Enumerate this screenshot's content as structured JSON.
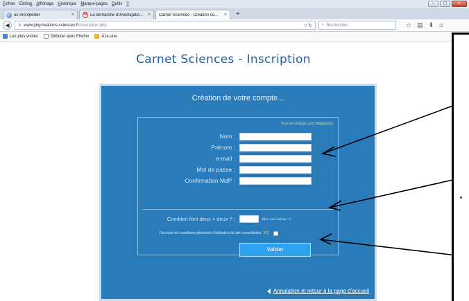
{
  "browser": {
    "menu": [
      {
        "pre": "",
        "u": "F",
        "post": "ichier"
      },
      {
        "pre": "Éditio",
        "u": "n",
        "post": ""
      },
      {
        "pre": "",
        "u": "A",
        "post": "ffichage"
      },
      {
        "pre": "",
        "u": "H",
        "post": "istorique"
      },
      {
        "pre": "",
        "u": "M",
        "post": "arque-pages"
      },
      {
        "pre": "",
        "u": "O",
        "post": "utils"
      },
      {
        "pre": "",
        "u": "?",
        "post": ""
      }
    ],
    "tabs": [
      {
        "label": "ac-montpellier",
        "close": "×"
      },
      {
        "label": "La démarche d'investigatio...",
        "close": "×"
      },
      {
        "label": "Carnet Sciences - Création co...",
        "close": "×"
      }
    ],
    "new_tab": "+",
    "url": {
      "domain": "www.phgcreations-sciences.fr",
      "path": "/inscription.php"
    },
    "search_placeholder": "Rechercher",
    "bookmarks": [
      "Les plus visités",
      "Débuter avec Firefox",
      "À la une"
    ]
  },
  "page": {
    "title": "Carnet Sciences - Inscription"
  },
  "form": {
    "heading": "Création de votre compte...",
    "required_note": "Tous les champs sont obligatoires.",
    "fields": [
      {
        "label": "Nom :"
      },
      {
        "label": "Prénom :"
      },
      {
        "label": "e-mail :"
      },
      {
        "label": "Mot de passe :"
      },
      {
        "label": "Confirmation MdP :"
      }
    ],
    "captcha": {
      "label": "Combien font deux + deux ? :",
      "hint": "(êtes vous humain ?)"
    },
    "terms": {
      "text": "J'accepte les conditions générales d'utilisation du site consultables",
      "link": "ICI"
    },
    "submit_label": "Valider",
    "cancel_link": "Annulation et retour à la page d'accueil"
  }
}
